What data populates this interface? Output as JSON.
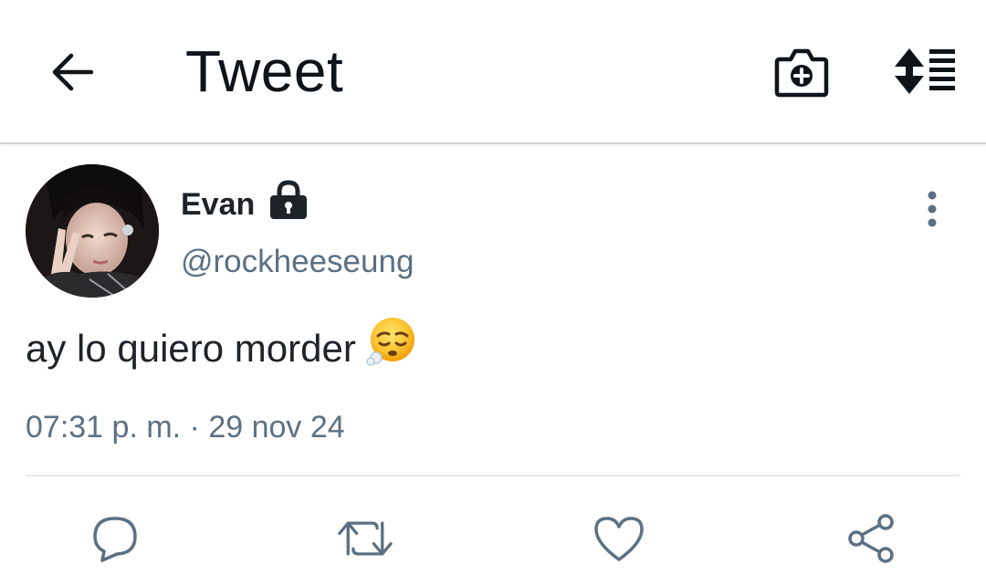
{
  "header": {
    "title": "Tweet",
    "back_icon": "arrow-left-icon",
    "camera_icon": "camera-plus-icon",
    "sort_icon": "sort-lines-icon"
  },
  "tweet": {
    "display_name": "Evan",
    "username": "@rockheeseung",
    "protected_icon": "lock-icon",
    "text": "ay lo quiero morder",
    "emoji": "face-exhaling-emoji",
    "timestamp": "07:31 p. m. · 29 nov 24",
    "avatar": "user-avatar-photo"
  },
  "actions": {
    "reply_icon": "reply-bubble-icon",
    "retweet_icon": "retweet-icon",
    "like_icon": "heart-icon",
    "share_icon": "share-icon"
  },
  "colors": {
    "text_primary": "#0f1419",
    "text_secondary": "#5b7083",
    "divider": "#e6e9eb",
    "icon_gray": "#5b7083"
  }
}
